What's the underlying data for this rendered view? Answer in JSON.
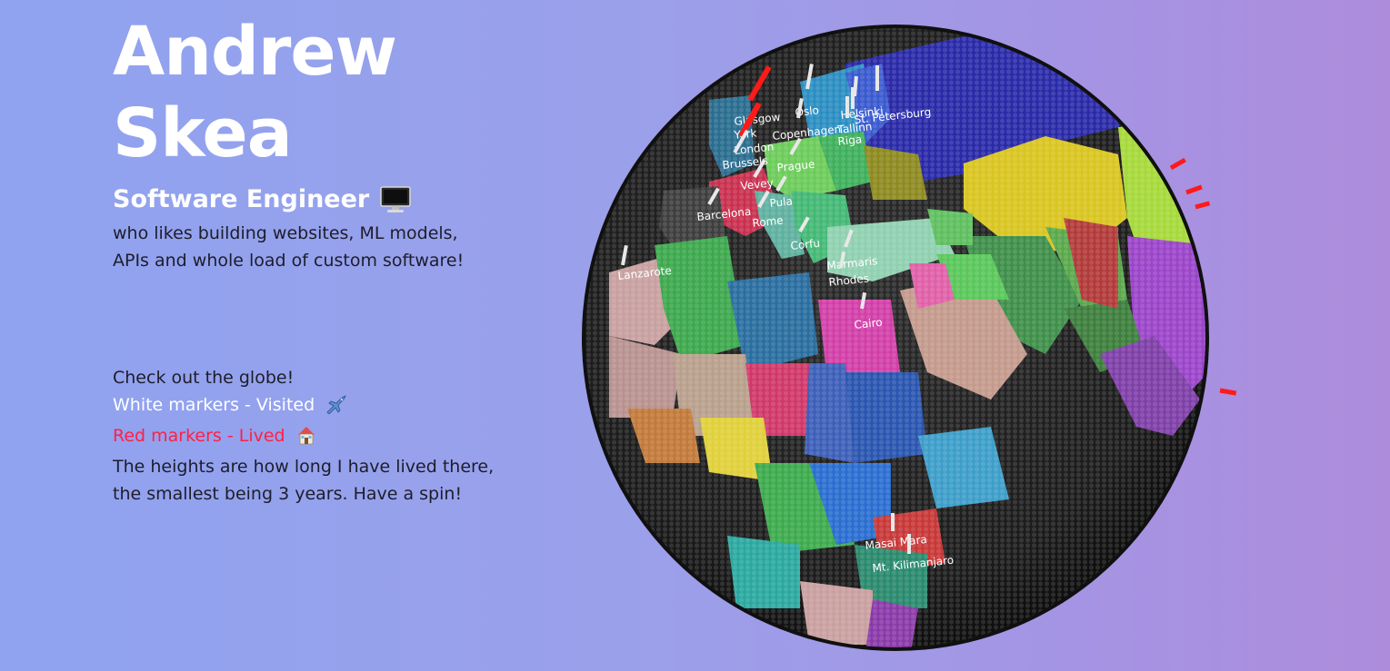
{
  "profile": {
    "name_line1": "Andrew",
    "name_line2": "Skea",
    "role": "Software Engineer",
    "role_icon": "desktop-computer-icon",
    "tagline": "who likes building websites, ML models, APIs and whole load of custom software!"
  },
  "legend": {
    "intro": "Check out the globe!",
    "visited": "White markers - Visited",
    "visited_icon": "airplane-icon",
    "lived": "Red markers - Lived",
    "lived_icon": "house-icon",
    "note_line1": "The heights are how long I have lived there,",
    "note_line2": "the smallest being 3 years. Have a spin!"
  },
  "globe": {
    "visited_color": "#e8e8e8",
    "lived_color": "#ff1a1a",
    "ocean_color": "#1e1e1e",
    "cities": [
      {
        "name": "Lanzarote"
      },
      {
        "name": "Glasgow"
      },
      {
        "name": "York"
      },
      {
        "name": "London"
      },
      {
        "name": "Brussels"
      },
      {
        "name": "Vevey"
      },
      {
        "name": "Barcelona"
      },
      {
        "name": "Oslo"
      },
      {
        "name": "Helsinki"
      },
      {
        "name": "St. Petersburg"
      },
      {
        "name": "Copenhagen"
      },
      {
        "name": "Tallinn"
      },
      {
        "name": "Riga"
      },
      {
        "name": "Prague"
      },
      {
        "name": "Pula"
      },
      {
        "name": "Rome"
      },
      {
        "name": "Corfu"
      },
      {
        "name": "Marmaris"
      },
      {
        "name": "Rhodes"
      },
      {
        "name": "Cairo"
      },
      {
        "name": "Masai Mara"
      },
      {
        "name": "Mt. Kilimanjaro"
      }
    ]
  }
}
